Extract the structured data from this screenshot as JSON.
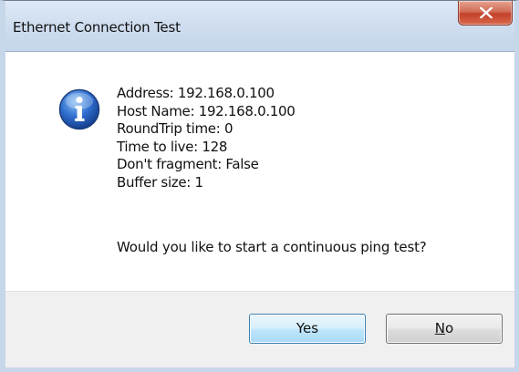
{
  "window": {
    "title": "Ethernet Connection Test",
    "close_icon": "close-icon"
  },
  "message": {
    "icon": "information-icon",
    "lines": [
      "Address: 192.168.0.100",
      "Host Name: 192.168.0.100",
      "RoundTrip time: 0",
      "Time to live: 128",
      "Don't fragment: False",
      "Buffer size: 1"
    ],
    "question": "Would you like to start a continuous ping test?"
  },
  "buttons": {
    "yes_label": "Yes",
    "no_label": "No"
  },
  "colors": {
    "titlebar": "#cddcee",
    "close_button": "#c4402a",
    "footer": "#f0f0f0",
    "default_button_border": "#3c7fb1"
  }
}
